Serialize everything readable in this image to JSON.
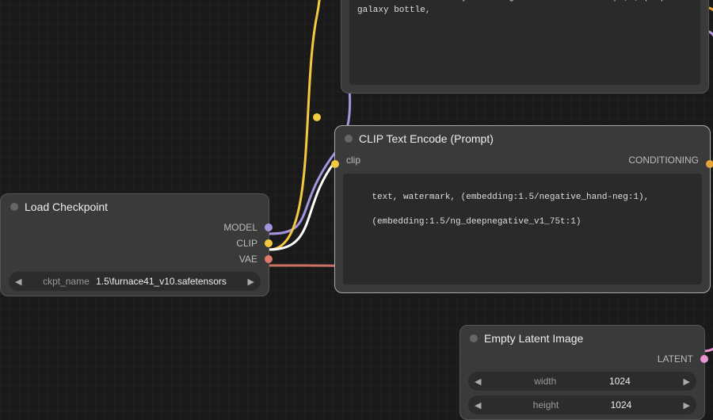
{
  "load_checkpoint": {
    "title": "Load Checkpoint",
    "outputs": {
      "model": "MODEL",
      "clip": "CLIP",
      "vae": "VAE"
    },
    "ckpt_name_label": "ckpt_name",
    "ckpt_name_value": "1.5\\furnace41_v10.safetensors"
  },
  "prompt_a": {
    "text": "beautiful scenery nature glass bottle landscape, , purple galaxy bottle,"
  },
  "prompt_b": {
    "title": "CLIP Text Encode (Prompt)",
    "input_label": "clip",
    "output_label": "CONDITIONING",
    "text_line1": "text, watermark, (embedding:1.5/negative_hand-neg:1),",
    "text_line2": "(embedding:1.5/ng_deepnegative_v1_75t:1)"
  },
  "empty_latent": {
    "title": "Empty Latent Image",
    "output_label": "LATENT",
    "width_label": "width",
    "width_value": "1024",
    "height_label": "height",
    "height_value": "1024"
  },
  "colors": {
    "model": "#a694e0",
    "clip": "#f5c842",
    "vae": "#e07b6c",
    "conditioning": "#e8a23a",
    "latent": "#e895d4"
  }
}
